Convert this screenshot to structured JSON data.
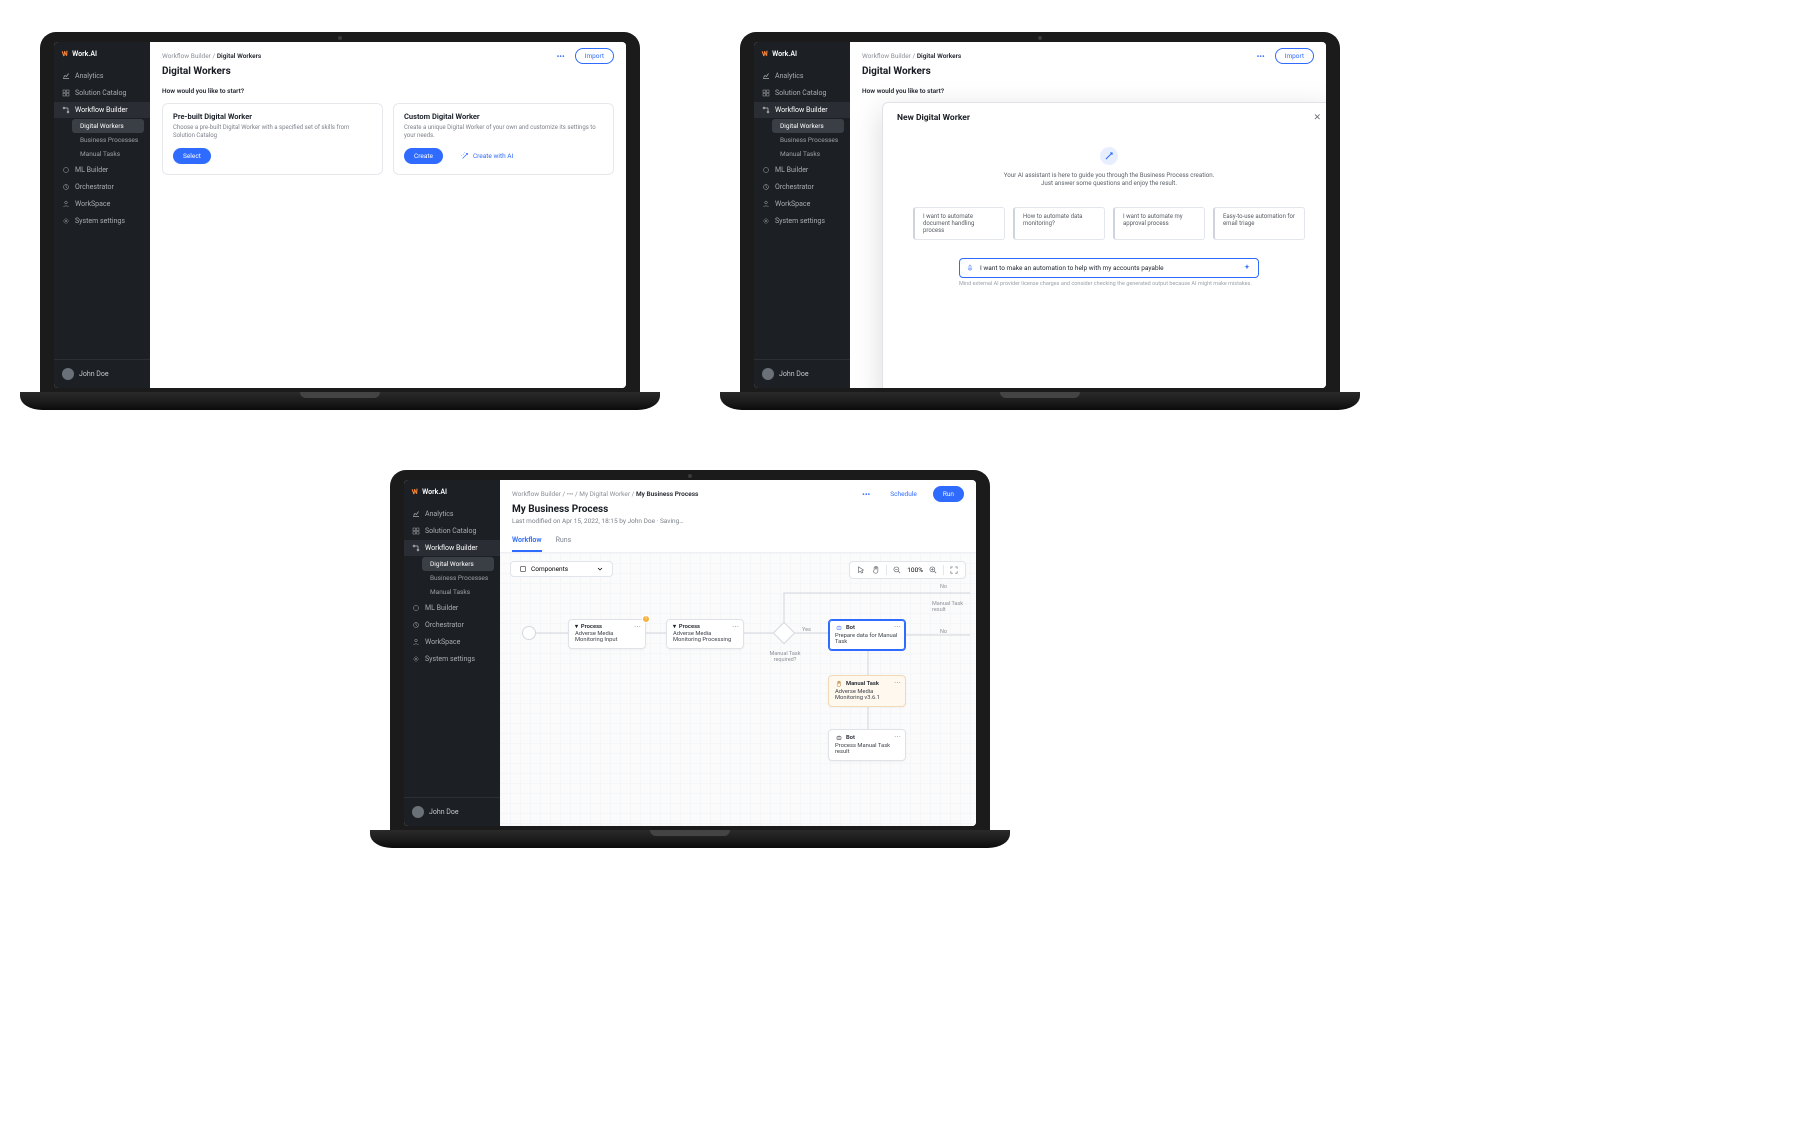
{
  "brand": "Work.AI",
  "sidebar": {
    "items": [
      {
        "label": "Analytics"
      },
      {
        "label": "Solution Catalog"
      },
      {
        "label": "Workflow Builder"
      },
      {
        "label": "ML Builder"
      },
      {
        "label": "Orchestrator"
      },
      {
        "label": "WorkSpace"
      },
      {
        "label": "System settings"
      }
    ],
    "wb_children": [
      {
        "label": "Digital Workers"
      },
      {
        "label": "Business Processes"
      },
      {
        "label": "Manual Tasks"
      }
    ]
  },
  "user_name": "John Doe",
  "screen1": {
    "breadcrumb": {
      "a": "Workflow Builder",
      "b": "Digital Workers"
    },
    "page_title": "Digital Workers",
    "import": "Import",
    "question": "How would you like to start?",
    "card1": {
      "title": "Pre-built Digital Worker",
      "desc": "Choose a pre-built Digital Worker with a specified set of skills from Solution Catalog",
      "btn": "Select"
    },
    "card2": {
      "title": "Custom Digital Worker",
      "desc": "Create a unique Digital Worker of your own and customize its settings to your needs.",
      "btn": "Create",
      "ai_btn": "Create with AI"
    }
  },
  "screen2": {
    "modal_title": "New Digital Worker",
    "hero_line1": "Your AI assistant is here to guide you through the Business Process creation.",
    "hero_line2": "Just answer some questions and enjoy the result.",
    "chips": [
      "I want to automate document handling process",
      "How to automate data monitoring?",
      "I want to automate my approval process",
      "Easy-to-use automation for email triage"
    ],
    "prompt_value": "I want to make an automation to help with my accounts payable",
    "prompt_caption": "Mind external AI provider license charges and consider checking the generated output because AI might make mistakes."
  },
  "screen3": {
    "breadcrumb": {
      "a": "Workflow Builder",
      "b": "My Digital Worker",
      "c": "My Business Process"
    },
    "page_title": "My Business Process",
    "subtitle": "Last modified on Apr 15, 2022, 18:15 by John Doe · Saving…",
    "schedule": "Schedule",
    "run": "Run",
    "tabs": {
      "workflow": "Workflow",
      "runs": "Runs"
    },
    "components": "Components",
    "zoom": "100%",
    "nodes": {
      "p1_head": "Process",
      "p1_body": "Adverse Media Monitoring Input",
      "p2_head": "Process",
      "p2_body": "Adverse Media Monitoring Processing",
      "b1_head": "Bot",
      "b1_body": "Prepare data for Manual Task",
      "mt_head": "Manual Task",
      "mt_body": "Adverse Media Monitoring v3.6.1",
      "b2_head": "Bot",
      "b2_body": "Process Manual Task result",
      "gate_label": "Manual Task required?",
      "yes": "Yes",
      "no": "No",
      "end1": "Manual Task result",
      "end2": "No"
    }
  }
}
